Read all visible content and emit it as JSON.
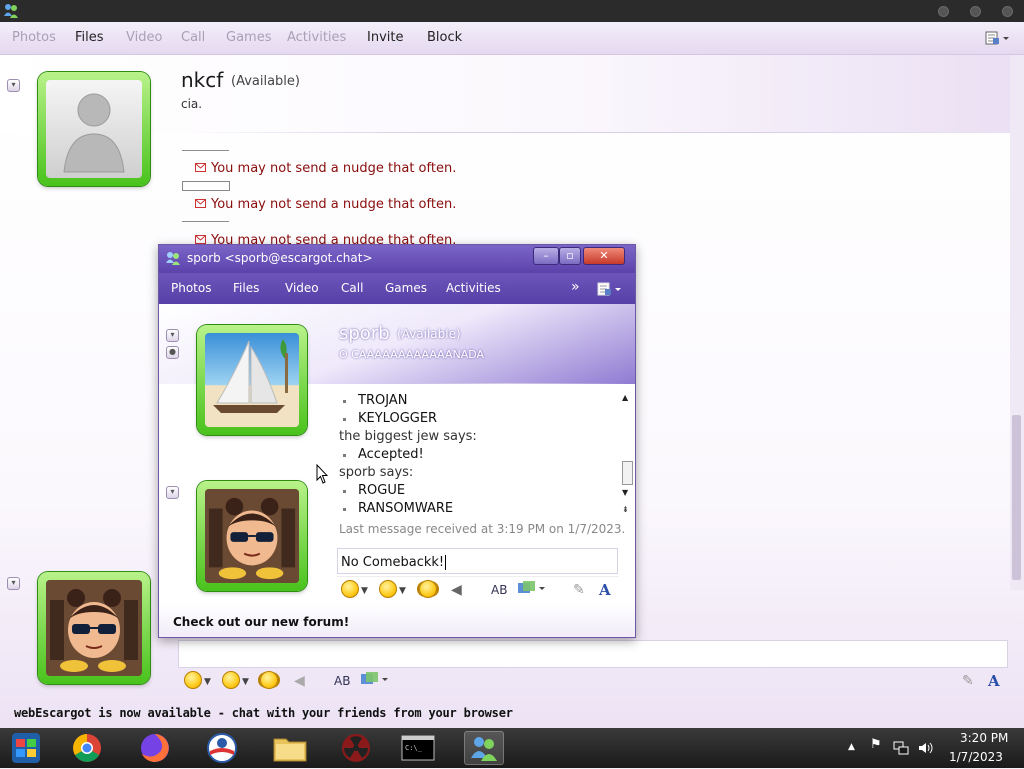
{
  "main_window": {
    "menu": [
      {
        "label": "Photos",
        "enabled": false
      },
      {
        "label": "Files",
        "enabled": true
      },
      {
        "label": "Video",
        "enabled": false
      },
      {
        "label": "Call",
        "enabled": false
      },
      {
        "label": "Games",
        "enabled": false
      },
      {
        "label": "Activities",
        "enabled": false
      },
      {
        "label": "Invite",
        "enabled": true
      },
      {
        "label": "Block",
        "enabled": true
      }
    ],
    "contact": {
      "name": "nkcf",
      "status": "(Available)",
      "psm": "cia."
    },
    "messages": [
      "You may not send a nudge that often.",
      "You may not send a nudge that often.",
      "You may not send a nudge that often."
    ],
    "status_bar": "webEscargot is now available - chat with your friends from your browser"
  },
  "popup": {
    "title": "sporb <sporb@escargot.chat>",
    "menu": [
      "Photos",
      "Files",
      "Video",
      "Call",
      "Games",
      "Activities"
    ],
    "more": "»",
    "contact": {
      "name": "sporb",
      "status": "(Available)",
      "psm": "O CAAAAAAAAAAAANADA"
    },
    "conversation": [
      {
        "type": "bullet",
        "text": "TROJAN"
      },
      {
        "type": "bullet",
        "text": "KEYLOGGER"
      },
      {
        "type": "says",
        "text": "the biggest jew says:"
      },
      {
        "type": "bullet",
        "text": "Accepted!"
      },
      {
        "type": "says",
        "text": "sporb says:"
      },
      {
        "type": "bullet",
        "text": "ROGUE"
      },
      {
        "type": "bullet",
        "text": "RANSOMWARE"
      }
    ],
    "last_message": "Last message received at 3:19 PM on 1/7/2023.",
    "input_value": "No Comebackk!",
    "footer": "Check out our new forum!"
  },
  "taskbar": {
    "apps": [
      "start-orb",
      "chrome",
      "firefox",
      "obama-app",
      "file-explorer",
      "radiation-app",
      "command-prompt",
      "escargot-messenger"
    ],
    "clock_time": "3:20 PM",
    "clock_date": "1/7/2023",
    "tray_icons": [
      "show-hidden-icons",
      "flag",
      "network",
      "volume"
    ]
  },
  "colors": {
    "nudge_text": "#8a0d0d",
    "popup_title": "#5b42ac",
    "avatar_frame": "#49c21c",
    "taskbar": "#1a1a1a"
  }
}
